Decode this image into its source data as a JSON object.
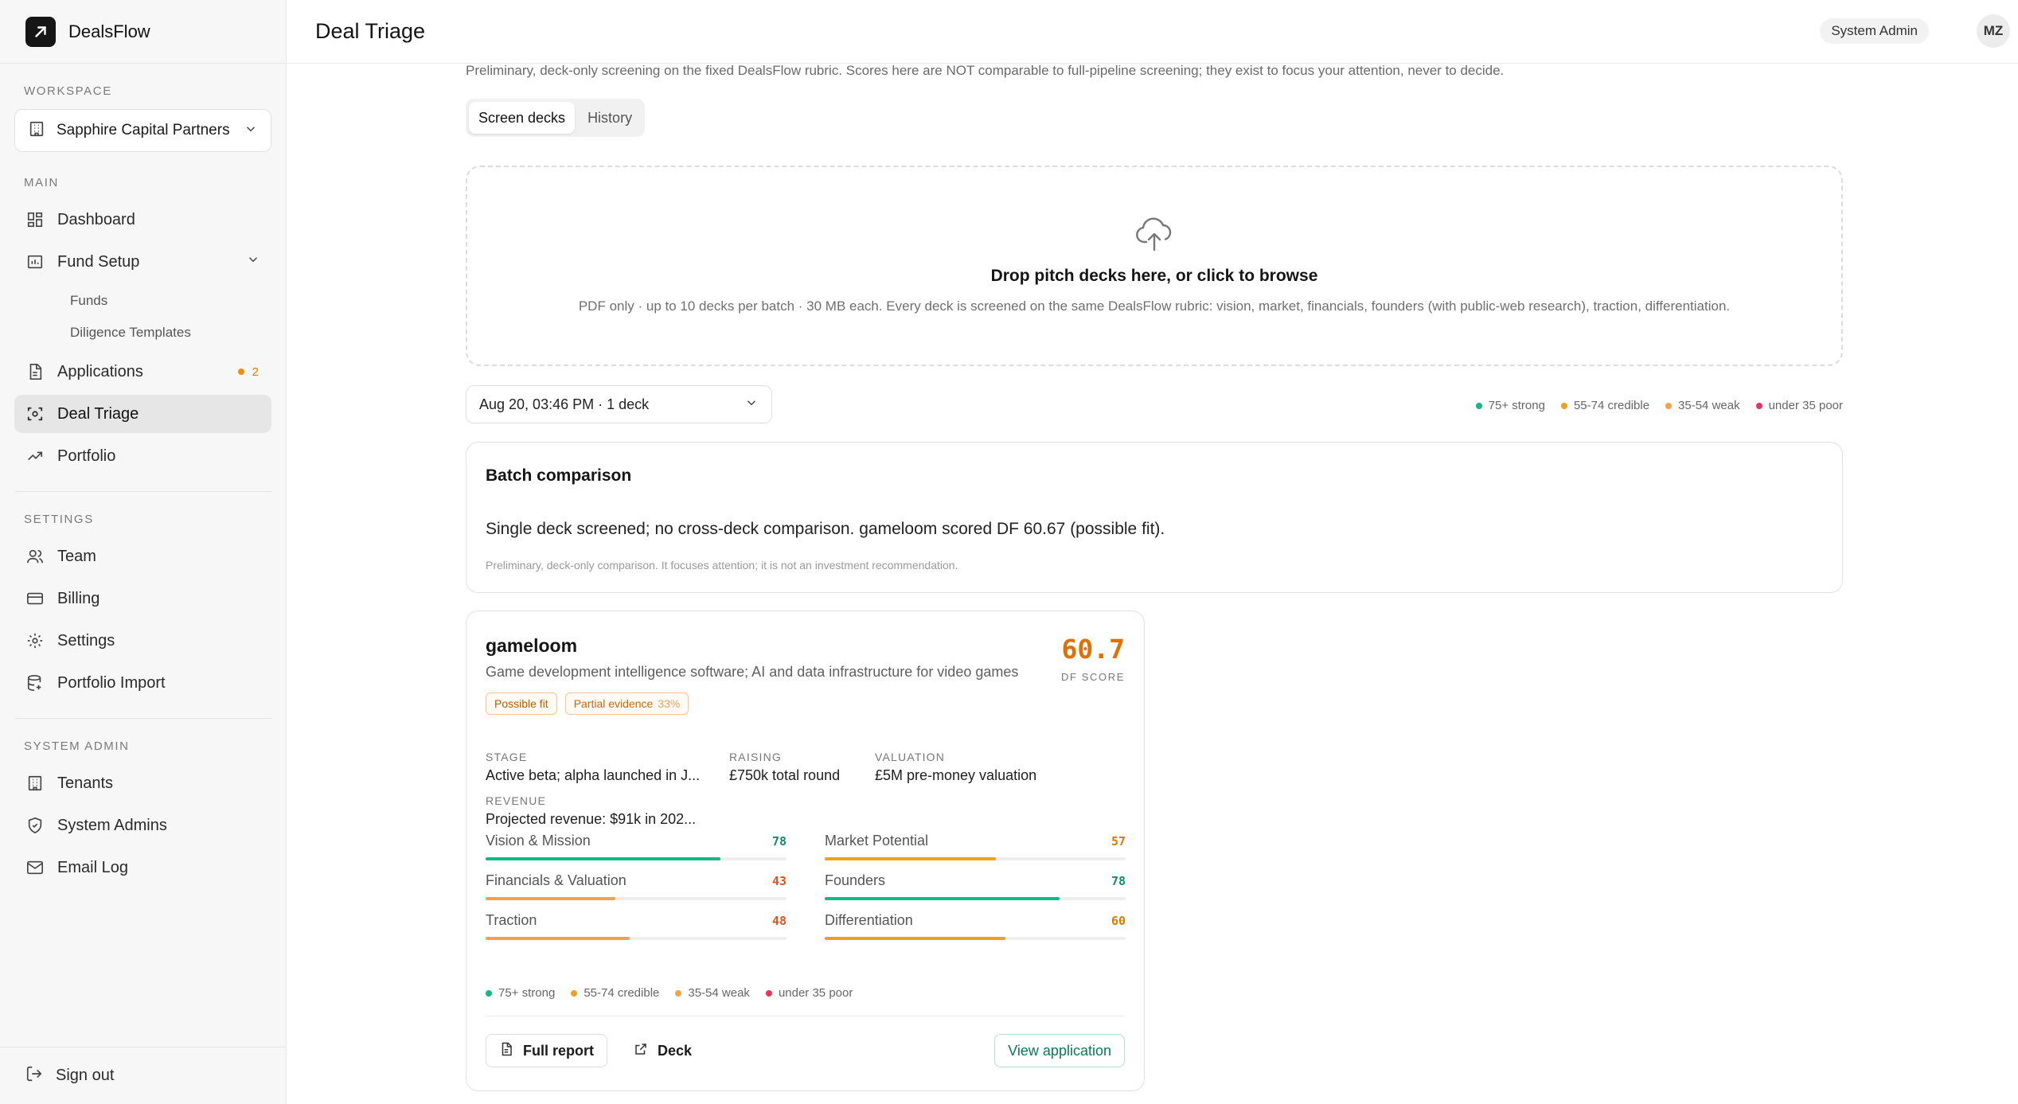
{
  "app": {
    "name": "DealsFlow",
    "page_title": "Deal Triage",
    "role_label": "System Admin",
    "avatar_initials": "MZ"
  },
  "sidebar": {
    "workspace_label": "WORKSPACE",
    "workspace_name": "Sapphire Capital Partners",
    "main_label": "MAIN",
    "main_items": [
      {
        "label": "Dashboard",
        "icon": "dashboard-icon"
      },
      {
        "label": "Fund Setup",
        "icon": "chart-bar-icon"
      },
      {
        "label": "Applications",
        "icon": "file-icon",
        "badge": "2"
      },
      {
        "label": "Deal Triage",
        "icon": "scan-icon",
        "active": true
      },
      {
        "label": "Portfolio",
        "icon": "trend-up-icon"
      }
    ],
    "fund_setup_subitems": [
      "Funds",
      "Diligence Templates"
    ],
    "settings_label": "SETTINGS",
    "settings_items": [
      {
        "label": "Team",
        "icon": "users-icon"
      },
      {
        "label": "Billing",
        "icon": "credit-card-icon"
      },
      {
        "label": "Settings",
        "icon": "gear-icon"
      },
      {
        "label": "Portfolio Import",
        "icon": "database-icon"
      }
    ],
    "system_admin_label": "SYSTEM ADMIN",
    "system_admin_items": [
      {
        "label": "Tenants",
        "icon": "building-icon"
      },
      {
        "label": "System Admins",
        "icon": "shield-icon"
      },
      {
        "label": "Email Log",
        "icon": "mail-icon"
      }
    ],
    "sign_out": "Sign out"
  },
  "main": {
    "intro": "Preliminary, deck-only screening on the fixed DealsFlow rubric. Scores here are NOT comparable to full-pipeline screening; they exist to focus your attention, never to decide.",
    "tabs": [
      {
        "label": "Screen decks",
        "active": true
      },
      {
        "label": "History",
        "active": false
      }
    ],
    "dropzone": {
      "title": "Drop pitch decks here, or click to browse",
      "subtitle": "PDF only · up to 10 decks per batch · 30 MB each. Every deck is screened on the same DealsFlow rubric: vision, market, financials, founders (with public-web research), traction, differentiation."
    },
    "batch_select": "Aug 20, 03:46 PM · 1 deck",
    "legend": [
      {
        "label": "75+ strong",
        "color": "#12b886"
      },
      {
        "label": "55-74 credible",
        "color": "#f0a01c"
      },
      {
        "label": "35-54 weak",
        "color": "#f7a04c"
      },
      {
        "label": "under 35 poor",
        "color": "#e8335a"
      }
    ],
    "batch_comparison": {
      "title": "Batch comparison",
      "body": "Single deck screened; no cross-deck comparison. gameloom scored DF 60.67 (possible fit).",
      "note": "Preliminary, deck-only comparison. It focuses attention; it is not an investment recommendation."
    },
    "deal": {
      "name": "gameloom",
      "description": "Game development intelligence software; AI and data infrastructure for video games",
      "tag_fit": "Possible fit",
      "tag_evidence": "Partial evidence",
      "tag_evidence_pct": "33%",
      "score": "60.7",
      "score_label": "DF SCORE",
      "stage_label": "STAGE",
      "stage": "Active beta; alpha launched in J...",
      "raising_label": "RAISING",
      "raising": "£750k total round",
      "valuation_label": "VALUATION",
      "valuation": "£5M pre-money valuation",
      "revenue_label": "REVENUE",
      "revenue": "Projected revenue: $91k in 202...",
      "metrics": [
        {
          "name": "Vision & Mission",
          "value": 78,
          "color": "#12b886",
          "text_color": "#0f8f68"
        },
        {
          "name": "Market Potential",
          "value": 57,
          "color": "#f0a01c",
          "text_color": "#d97a00"
        },
        {
          "name": "Financials & Valuation",
          "value": 43,
          "color": "#f7a04c",
          "text_color": "#e2531c"
        },
        {
          "name": "Founders",
          "value": 78,
          "color": "#12b886",
          "text_color": "#0f8f68"
        },
        {
          "name": "Traction",
          "value": 48,
          "color": "#f7a04c",
          "text_color": "#e2531c"
        },
        {
          "name": "Differentiation",
          "value": 60,
          "color": "#f0a01c",
          "text_color": "#d97a00"
        }
      ],
      "buttons": {
        "full_report": "Full report",
        "deck": "Deck",
        "view_application": "View application"
      }
    }
  }
}
